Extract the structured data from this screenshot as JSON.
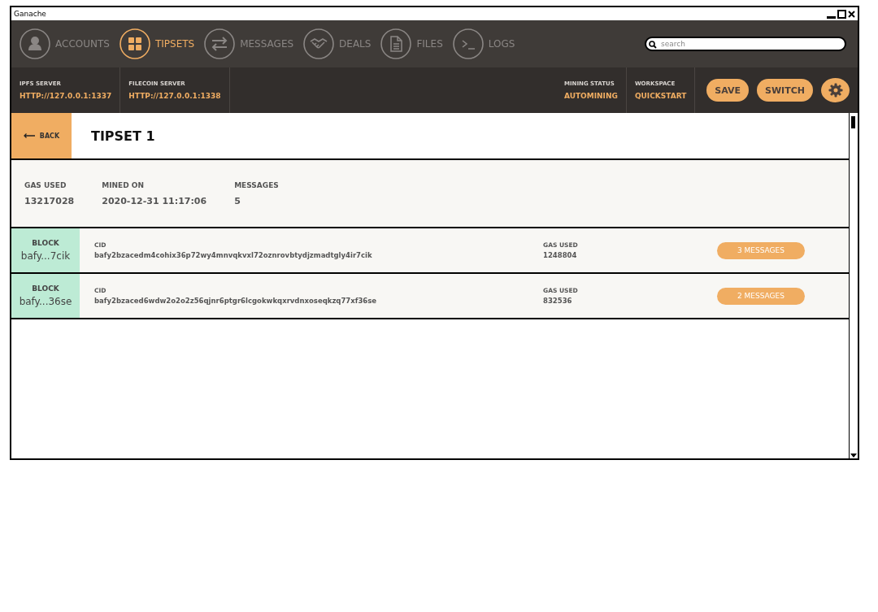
{
  "window": {
    "title": "Ganache"
  },
  "nav": {
    "items": [
      {
        "label": "ACCOUNTS",
        "selected": false
      },
      {
        "label": "TIPSETS",
        "selected": true
      },
      {
        "label": "MESSAGES",
        "selected": false
      },
      {
        "label": "DEALS",
        "selected": false
      },
      {
        "label": "FILES",
        "selected": false
      },
      {
        "label": "LOGS",
        "selected": false
      }
    ],
    "search": {
      "placeholder": "search"
    }
  },
  "status_bar": {
    "servers": [
      {
        "label": "IPFS SERVER",
        "value": "HTTP://127.0.0.1:1337"
      },
      {
        "label": "FILECOIN SERVER",
        "value": "HTTP://127.0.0.1:1338"
      }
    ],
    "info": [
      {
        "label": "MINING STATUS",
        "value": "AUTOMINING"
      },
      {
        "label": "WORKSPACE",
        "value": "QUICKSTART"
      }
    ],
    "buttons": [
      "SAVE",
      "SWITCH"
    ]
  },
  "tipset": {
    "back": "BACK",
    "title": "TIPSET 1",
    "summary": [
      {
        "label": "GAS USED",
        "value": "13217028"
      },
      {
        "label": "MINED ON",
        "value": "2020-12-31 11:17:06"
      },
      {
        "label": "MESSAGES",
        "value": "5"
      }
    ],
    "blocks": [
      {
        "tag": "BLOCK",
        "short": "bafy...7cik",
        "cid_label": "CID",
        "cid": "bafy2bzacedm4cohix36p72wy4mnvqkvxl72oznrovbtydjzmadtgly4ir7cik",
        "gas_label": "GAS USED",
        "gas": "1248804",
        "messages": "3 MESSAGES"
      },
      {
        "tag": "BLOCK",
        "short": "bafy...36se",
        "cid_label": "CID",
        "cid": "bafy2bzaced6wdw2o2o2z56qjnr6ptgr6lcgokwkqxrvdnxoseqkzq77xf36se",
        "gas_label": "GAS USED",
        "gas": "832536",
        "messages": "2 MESSAGES"
      }
    ]
  }
}
